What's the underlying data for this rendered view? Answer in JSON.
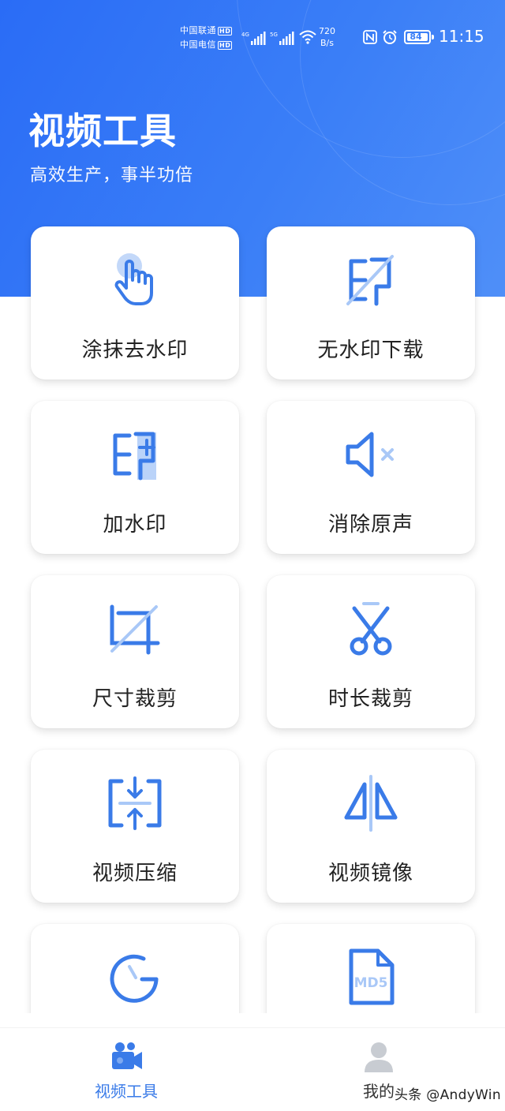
{
  "status_bar": {
    "carrier1": "中国联通",
    "carrier2": "中国电信",
    "hd": "HD",
    "net1": "4G",
    "net2": "5G",
    "speed_value": "720",
    "speed_unit": "B/s",
    "battery": "84",
    "time": "11:15"
  },
  "header": {
    "title": "视频工具",
    "subtitle": "高效生产，事半功倍"
  },
  "tools": [
    {
      "label": "涂抹去水印",
      "icon": "hand-tap-icon"
    },
    {
      "label": "无水印下载",
      "icon": "no-watermark-icon"
    },
    {
      "label": "加水印",
      "icon": "add-watermark-icon"
    },
    {
      "label": "消除原声",
      "icon": "mute-icon"
    },
    {
      "label": "尺寸裁剪",
      "icon": "crop-icon"
    },
    {
      "label": "时长裁剪",
      "icon": "scissors-icon"
    },
    {
      "label": "视频压缩",
      "icon": "compress-icon"
    },
    {
      "label": "视频镜像",
      "icon": "mirror-icon"
    },
    {
      "label": "",
      "icon": "speed-gauge-icon"
    },
    {
      "label": "",
      "icon": "md5-file-icon"
    }
  ],
  "md5_text": "MD5",
  "tabs": [
    {
      "label": "视频工具",
      "icon": "video-camera-icon",
      "active": true
    },
    {
      "label": "我的",
      "icon": "user-icon",
      "active": false
    }
  ],
  "watermark": "头条 @AndyWin",
  "colors": {
    "primary": "#2a6cf6",
    "icon_blue": "#3a7be8",
    "icon_light": "#a9c8f7",
    "tab_active": "#3a7be8",
    "tab_inactive": "#c8ccd2"
  }
}
